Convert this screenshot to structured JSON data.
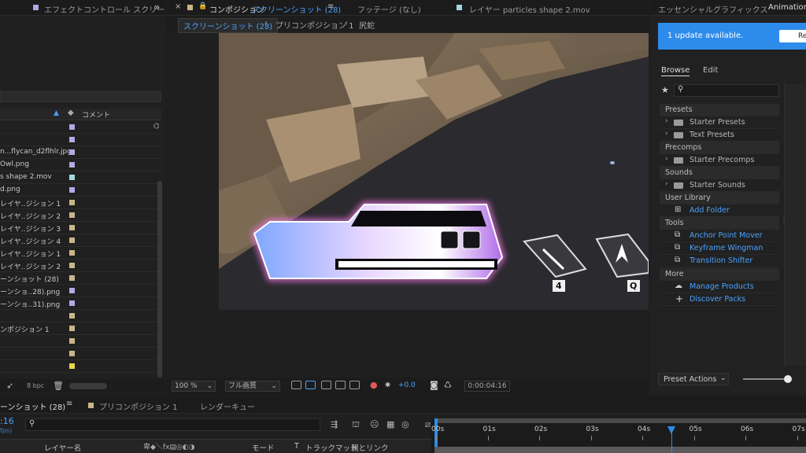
{
  "project_panel": {
    "tab_title": "エフェクトコントロール スクリー",
    "col_comment": "コメント",
    "bpc": "8 bpc",
    "items": [
      {
        "name": "",
        "color": "#b3a7e6"
      },
      {
        "name": "",
        "color": "#b3a7e6"
      },
      {
        "name": "n...flycan_d2flhlr.jpg",
        "color": "#b3a7e6"
      },
      {
        "name": "Owl.png",
        "color": "#b3a7e6"
      },
      {
        "name": "s shape 2.mov",
        "color": "#9fd8e0"
      },
      {
        "name": "d.png",
        "color": "#b3a7e6"
      },
      {
        "name": "レイヤ..ジション 1",
        "color": "#c9b58a"
      },
      {
        "name": "レイヤ..ジション 2",
        "color": "#c9b58a"
      },
      {
        "name": "レイヤ..ジション 3",
        "color": "#c9b58a"
      },
      {
        "name": "レイヤ..ジション 4",
        "color": "#c9b58a"
      },
      {
        "name": "レイヤ..ジション 1",
        "color": "#c9b58a"
      },
      {
        "name": "レイヤ..ジション 2",
        "color": "#c9b58a"
      },
      {
        "name": "ーンショット (28)",
        "color": "#c9b58a"
      },
      {
        "name": "ーンショ..28).png",
        "color": "#b3a7e6"
      },
      {
        "name": "ーンショ..31).png",
        "color": "#b3a7e6"
      },
      {
        "name": "",
        "color": "#c9b58a"
      },
      {
        "name": "ンポジション 1",
        "color": "#c9b58a"
      },
      {
        "name": "",
        "color": "#c9b58a"
      },
      {
        "name": "",
        "color": "#c9b58a"
      },
      {
        "name": "",
        "color": "#e8d44a"
      }
    ]
  },
  "comp_panel": {
    "tab_comp_prefix": "コンポジション",
    "tab_comp_name": "スクリーンショット (28)",
    "tab_footage": "フッテージ (なし)",
    "tab_layer": "レイヤー particles shape 2.mov",
    "breadcrumb": [
      "スクリーンショット (28)",
      "プリコンポジション 1",
      "尻蛇"
    ],
    "key_labels": [
      "4",
      "Q"
    ],
    "zoom": "100 %",
    "quality": "フル画質",
    "exposure": "+0.0",
    "timecode": "0:00:04:16"
  },
  "right_panel": {
    "tab_essential": "エッセンシャルグラフィックス",
    "tab_animation": "Animation C",
    "update_text": "1 update available.",
    "review_label": "Revi",
    "nav_browse": "Browse",
    "nav_edit": "Edit",
    "search_placeholder": "",
    "sections": {
      "presets": "Presets",
      "starter_presets": "Starter Presets",
      "text_presets": "Text Presets",
      "precomps": "Precomps",
      "starter_precomps": "Starter Precomps",
      "sounds": "Sounds",
      "starter_sounds": "Starter Sounds",
      "user_library": "User Library",
      "add_folder": "Add Folder",
      "tools": "Tools",
      "anchor_point_mover": "Anchor Point Mover",
      "keyframe_wingman": "Keyframe Wingman",
      "transition_shifter": "Transition Shifter",
      "more": "More",
      "manage_products": "Manage Products",
      "discover_packs": "Discover Packs"
    },
    "preset_actions": "Preset Actions",
    "slider_value": 0.95
  },
  "timeline": {
    "tab_comp": "ーンショット (28)",
    "tab_precomp": "プリコンポジション 1",
    "tab_render": "レンダーキュー",
    "time_short": ":16",
    "fps": "fps)",
    "search_placeholder": "",
    "col_layer_name": "レイヤー名",
    "col_mode": "モード",
    "col_t": "T",
    "col_trackmatte": "トラックマット",
    "col_parent": "親とリンク",
    "ruler": [
      "00s",
      "01s",
      "02s",
      "03s",
      "04s",
      "05s",
      "06s",
      "07s"
    ],
    "playhead_label": "04s"
  },
  "colors": {
    "accent_blue": "#2d8ceb",
    "link_blue": "#4aa3ff",
    "panel_bg": "#232323"
  }
}
